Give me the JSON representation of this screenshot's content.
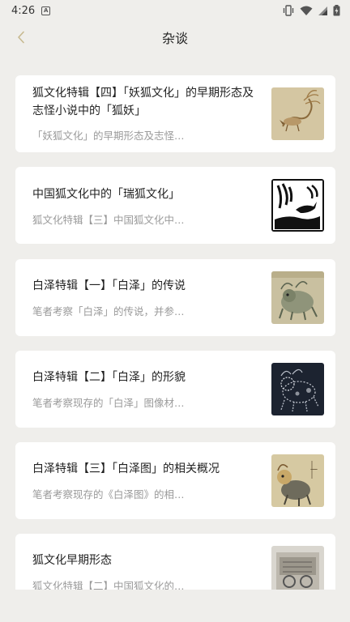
{
  "status": {
    "time": "4:26",
    "notif_letter": "A"
  },
  "header": {
    "title": "杂谈"
  },
  "articles": [
    {
      "title": "狐文化特辑【四】「妖狐文化」的早期形态及志怪小说中的「狐妖」",
      "summary": "「妖狐文化」的早期形态及志怪…"
    },
    {
      "title": "中国狐文化中的「瑞狐文化」",
      "summary": "狐文化特辑【三】中国狐文化中…"
    },
    {
      "title": "白泽特辑【一】「白泽」的传说",
      "summary": "笔者考察「白泽」的传说，并参…"
    },
    {
      "title": "白泽特辑【二】「白泽」的形貌",
      "summary": "笔者考察现存的「白泽」图像材…"
    },
    {
      "title": "白泽特辑【三】「白泽图」的相关概况",
      "summary": "笔者考察现存的《白泽图》的相…"
    },
    {
      "title": "狐文化早期形态",
      "summary": "狐文化特辑【二】中国狐文化的…"
    }
  ]
}
